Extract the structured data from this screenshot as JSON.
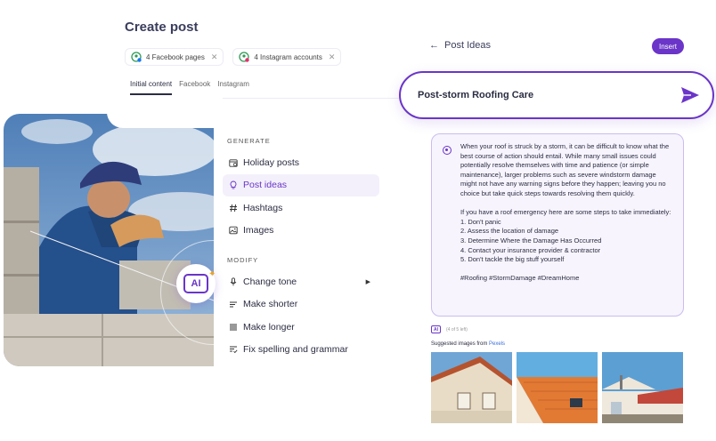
{
  "create_post": {
    "title": "Create post",
    "chips": [
      {
        "label": "4 Facebook pages",
        "icon": "facebook-account-icon"
      },
      {
        "label": "4 Instagram accounts",
        "icon": "instagram-account-icon"
      }
    ],
    "tabs": [
      "Initial content",
      "Facebook",
      "Instagram"
    ],
    "active_tab": "Initial content",
    "toolbar_icons": [
      "camera-icon",
      "emoji-icon",
      "ai-icon"
    ]
  },
  "ai_badge": {
    "label": "AI"
  },
  "menu": {
    "generate_heading": "GENERATE",
    "generate_items": [
      {
        "label": "Holiday posts",
        "icon": "calendar-icon"
      },
      {
        "label": "Post ideas",
        "icon": "lightbulb-icon",
        "active": true
      },
      {
        "label": "Hashtags",
        "icon": "hashtag-icon"
      },
      {
        "label": "Images",
        "icon": "image-icon"
      }
    ],
    "modify_heading": "MODIFY",
    "modify_items": [
      {
        "label": "Change tone",
        "icon": "microphone-icon",
        "has_submenu": true
      },
      {
        "label": "Make shorter",
        "icon": "shorten-icon"
      },
      {
        "label": "Make longer",
        "icon": "lengthen-icon"
      },
      {
        "label": "Fix spelling and grammar",
        "icon": "spellcheck-icon"
      }
    ]
  },
  "post_ideas": {
    "title": "Post Ideas",
    "insert_label": "Insert",
    "prompt": "Post-storm Roofing Care",
    "result_paragraph": "When your roof is struck by a storm, it can be difficult to know what the best course of action should entail. While many small issues could potentially resolve themselves with time and patience (or simple maintenance), larger problems such as severe windstorm damage might not have any warning signs before they happen; leaving you no choice but take quick steps towards resolving them quickly.",
    "result_intro": "If you have a roof emergency here are some steps to take immediately:",
    "result_steps": [
      "1. Don't panic",
      "2. Assess the location of damage",
      "3. Determine Where the Damage Has Occurred",
      "4. Contact your insurance provider & contractor",
      "5. Don't tackle the big stuff yourself"
    ],
    "result_hashtags": "#Roofing #StormDamage #DreamHome",
    "ai_mini_label": "AI",
    "usage_count": "(4 of 5 left)",
    "suggested_prefix": "Suggested images from ",
    "suggested_source": "Pexels"
  },
  "colors": {
    "accent": "#6a35c8",
    "accent_light": "#f7f4fd",
    "text": "#2b2d42"
  }
}
